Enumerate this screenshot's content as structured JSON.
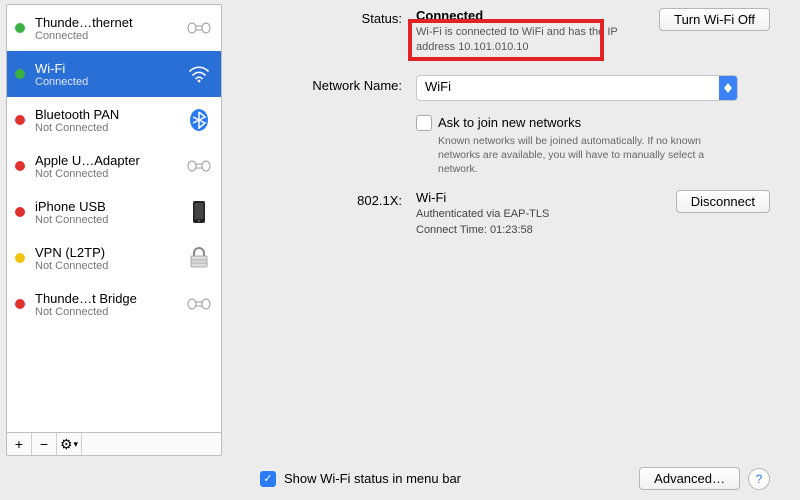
{
  "sidebar": {
    "services": [
      {
        "dot": "green",
        "name": "Thunde…thernet",
        "status": "Connected",
        "icon": "eth"
      },
      {
        "dot": "green",
        "name": "Wi-Fi",
        "status": "Connected",
        "icon": "wifi"
      },
      {
        "dot": "red",
        "name": "Bluetooth PAN",
        "status": "Not Connected",
        "icon": "bt"
      },
      {
        "dot": "red",
        "name": "Apple U…Adapter",
        "status": "Not Connected",
        "icon": "eth"
      },
      {
        "dot": "red",
        "name": "iPhone USB",
        "status": "Not Connected",
        "icon": "phone"
      },
      {
        "dot": "yellow",
        "name": "VPN (L2TP)",
        "status": "Not Connected",
        "icon": "lock"
      },
      {
        "dot": "red",
        "name": "Thunde…t Bridge",
        "status": "Not Connected",
        "icon": "eth"
      }
    ],
    "selected_index": 1,
    "tools": {
      "add": "+",
      "remove": "−",
      "gear": "⚙︎",
      "dropdown": "▾"
    }
  },
  "main": {
    "labels": {
      "status": "Status:",
      "network_name": "Network Name:",
      "dot1x": "802.1X:"
    },
    "status_value": "Connected",
    "wifi_off_btn": "Turn Wi-Fi Off",
    "status_detail": "Wi-Fi is connected to WiFi and has the IP address 10.101.010.10",
    "network_select": "WiFi",
    "ask_to_join": "Ask to join new networks",
    "ask_to_join_hint": "Known networks will be joined automatically. If no known networks are available, you will have to manually select a network.",
    "dot1x_value": "Wi-Fi",
    "disconnect_btn": "Disconnect",
    "auth_line1": "Authenticated via EAP-TLS",
    "auth_line2": "Connect Time: 01:23:58"
  },
  "footer": {
    "show_status": "Show Wi-Fi status in menu bar",
    "advanced_btn": "Advanced…",
    "help": "?"
  }
}
